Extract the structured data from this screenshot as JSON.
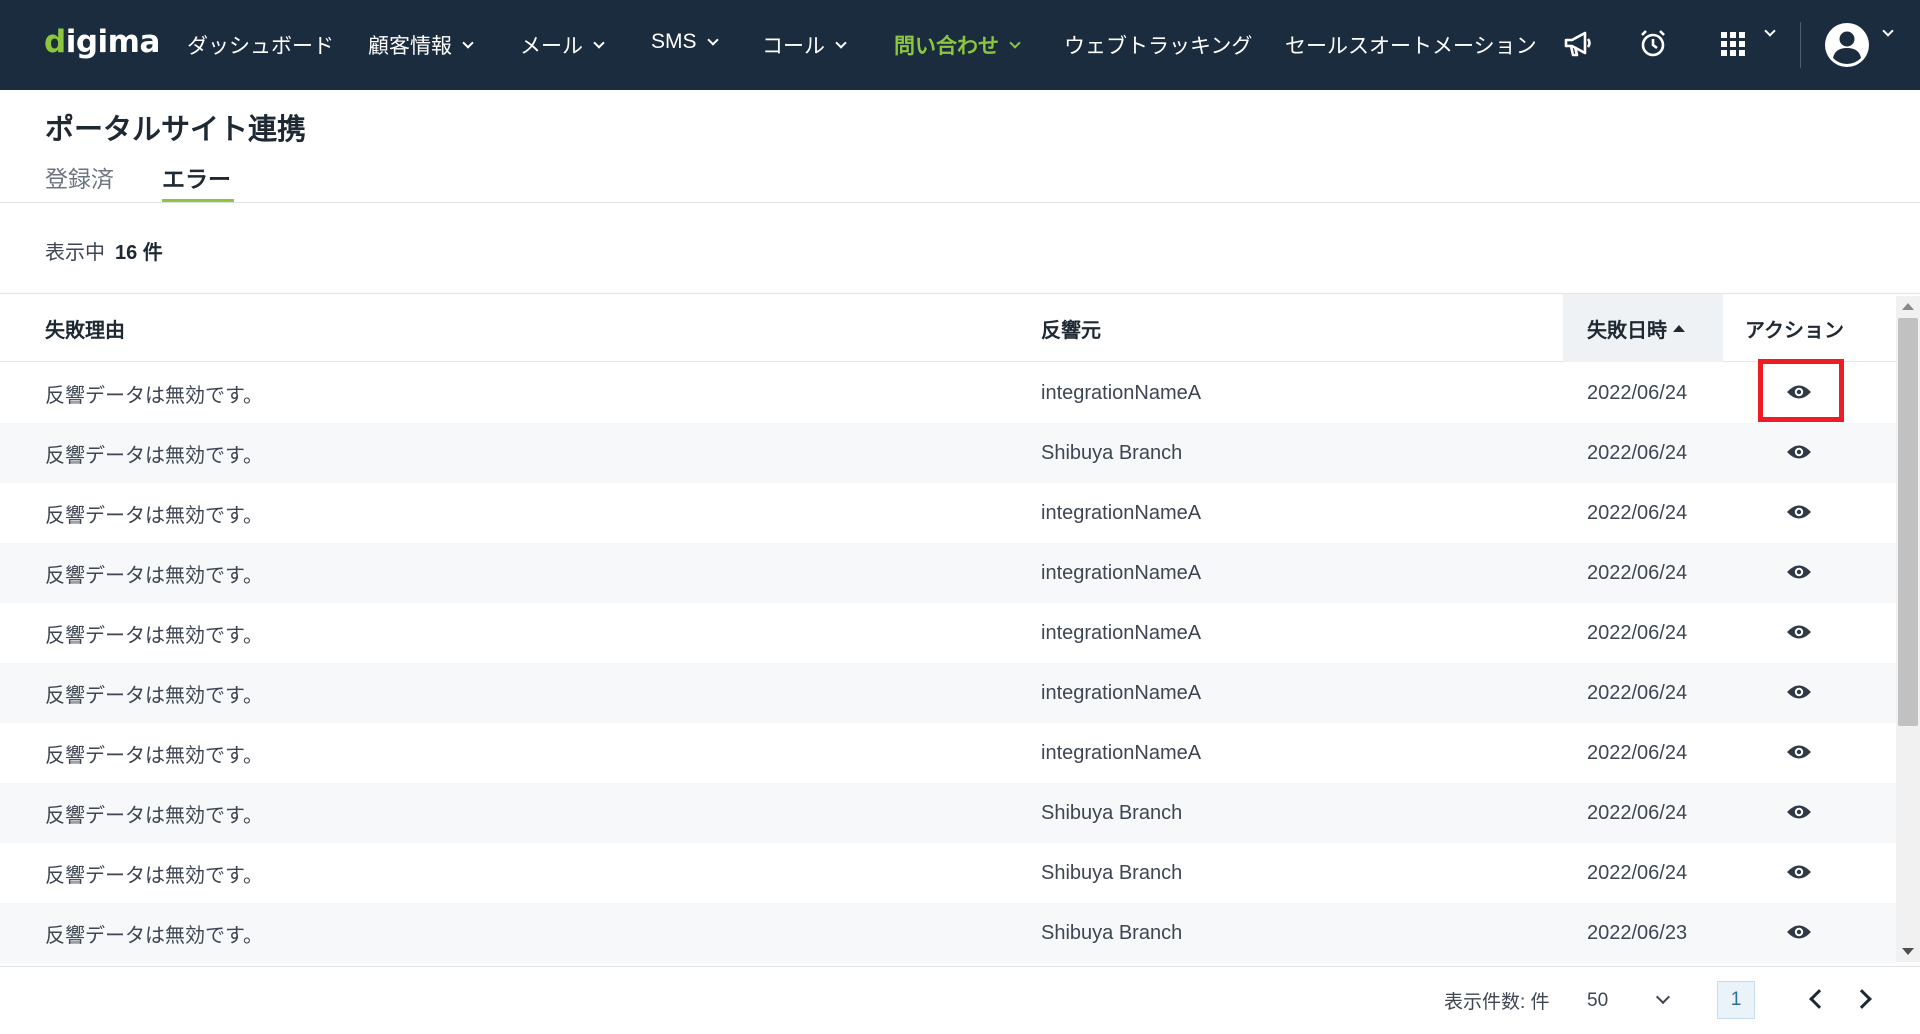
{
  "nav": {
    "logo_accent": "d",
    "logo_rest": "igima",
    "items": [
      {
        "label": "ダッシュボード"
      },
      {
        "label": "顧客情報"
      },
      {
        "label": "メール"
      },
      {
        "label": "SMS"
      },
      {
        "label": "コール"
      },
      {
        "label": "問い合わせ"
      },
      {
        "label": "ウェブトラッキング"
      },
      {
        "label": "セールスオートメーション"
      }
    ],
    "icons": [
      "megaphone-icon",
      "alarm-clock-icon",
      "apps-grid-icon",
      "user-avatar-icon"
    ],
    "active_color": "#8cc63f",
    "background_color": "#1b2c3e"
  },
  "page": {
    "title": "ポータルサイト連携",
    "tabs": [
      {
        "label": "登録済"
      },
      {
        "label": "エラー"
      }
    ],
    "active_tab": "エラー",
    "count_prefix": "表示中",
    "count_value": "16 件"
  },
  "table": {
    "headers": {
      "reason": "失敗理由",
      "source": "反響元",
      "date": "失敗日時",
      "action": "アクション"
    },
    "sorted_by": "失敗日時",
    "sort_direction": "ascending",
    "rows": [
      {
        "reason": "反響データは無効です。",
        "source": "integrationNameA",
        "date": "2022/06/24"
      },
      {
        "reason": "反響データは無効です。",
        "source": "Shibuya Branch",
        "date": "2022/06/24"
      },
      {
        "reason": "反響データは無効です。",
        "source": "integrationNameA",
        "date": "2022/06/24"
      },
      {
        "reason": "反響データは無効です。",
        "source": "integrationNameA",
        "date": "2022/06/24"
      },
      {
        "reason": "反響データは無効です。",
        "source": "integrationNameA",
        "date": "2022/06/24"
      },
      {
        "reason": "反響データは無効です。",
        "source": "integrationNameA",
        "date": "2022/06/24"
      },
      {
        "reason": "反響データは無効です。",
        "source": "integrationNameA",
        "date": "2022/06/24"
      },
      {
        "reason": "反響データは無効です。",
        "source": "Shibuya Branch",
        "date": "2022/06/24"
      },
      {
        "reason": "反響データは無効です。",
        "source": "Shibuya Branch",
        "date": "2022/06/24"
      },
      {
        "reason": "反響データは無効です。",
        "source": "Shibuya Branch",
        "date": "2022/06/23"
      }
    ],
    "highlight_color": "#ee1c24"
  },
  "footer": {
    "per_page_label": "表示件数: 件",
    "per_page_value": "50",
    "current_page": "1"
  }
}
